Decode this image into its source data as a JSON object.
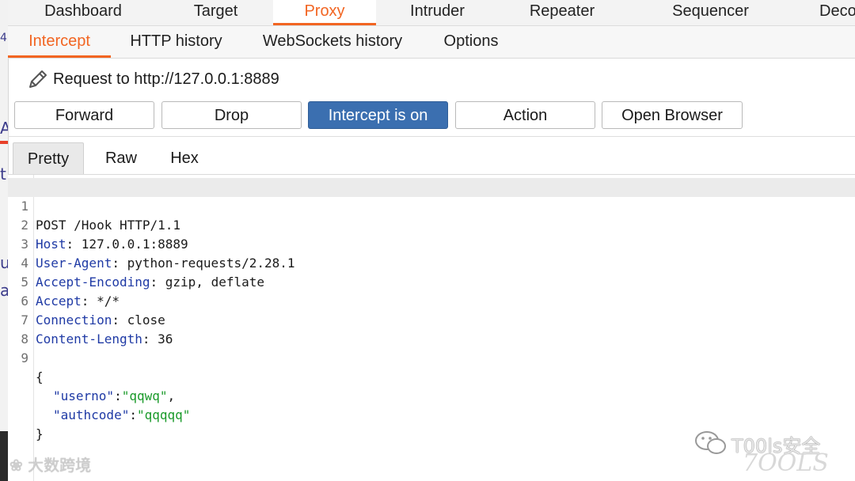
{
  "main_tabs": [
    "Dashboard",
    "Target",
    "Proxy",
    "Intruder",
    "Repeater",
    "Sequencer",
    "Deco"
  ],
  "sub_tabs": [
    "Intercept",
    "HTTP history",
    "WebSockets history",
    "Options"
  ],
  "request": {
    "label": "Request to http://127.0.0.1:8889"
  },
  "buttons": {
    "forward": "Forward",
    "drop": "Drop",
    "intercept": "Intercept is on",
    "action": "Action",
    "open_browser": "Open Browser"
  },
  "editor_tabs": [
    "Pretty",
    "Raw",
    "Hex"
  ],
  "lines": [
    {
      "n": "1",
      "text": "POST /Hook HTTP/1.1"
    },
    {
      "n": "2",
      "name": "Host",
      "value": ": 127.0.0.1:8889"
    },
    {
      "n": "3",
      "name": "User-Agent",
      "value": ": python-requests/2.28.1"
    },
    {
      "n": "4",
      "name": "Accept-Encoding",
      "value": ": gzip, deflate"
    },
    {
      "n": "5",
      "name": "Accept",
      "value": ": */*"
    },
    {
      "n": "6",
      "name": "Connection",
      "value": ": close"
    },
    {
      "n": "7",
      "name": "Content-Length",
      "value": ": 36"
    },
    {
      "n": "8",
      "text": ""
    },
    {
      "n": "9",
      "text": "{"
    },
    {
      "n": "",
      "key": "\"userno\"",
      "sep": ":",
      "val": "\"qqwq\"",
      "end": ","
    },
    {
      "n": "",
      "key": "\"authcode\"",
      "sep": ":",
      "val": "\"qqqqq\"",
      "end": ""
    },
    {
      "n": "",
      "text": "}"
    }
  ],
  "left_strip_chars": [
    "4",
    "A",
    "t",
    "u",
    "a"
  ],
  "watermarks": {
    "left": "大数跨境",
    "right": "T00ls安全",
    "signature": "7OOLS"
  },
  "colors": {
    "accent": "#f26522",
    "intercept_on": "#3b6fb0",
    "header_name": "#1f3aa5",
    "string": "#1a9a2a"
  }
}
